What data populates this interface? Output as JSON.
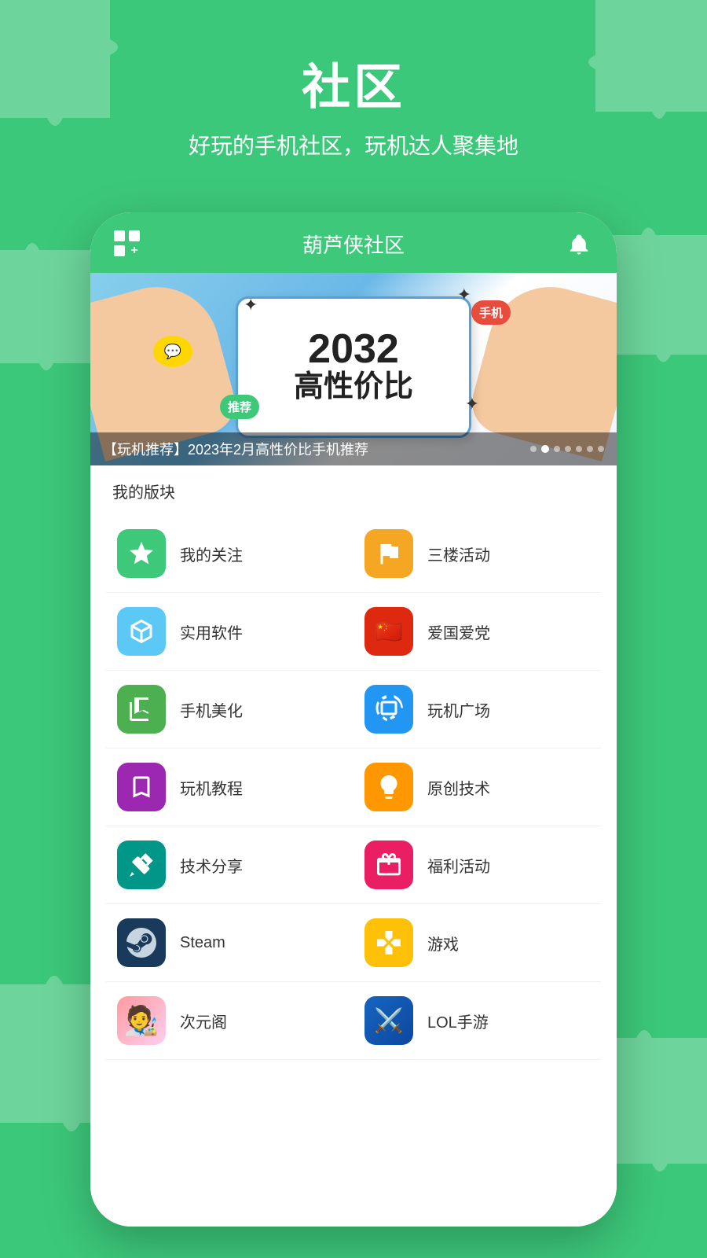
{
  "background": {
    "color": "#3cc87a"
  },
  "page": {
    "title": "社区",
    "subtitle": "好玩的手机社区，玩机达人聚集地"
  },
  "header": {
    "title": "葫芦侠社区",
    "grid_icon_label": "grid-plus-icon",
    "bell_icon_label": "bell-icon"
  },
  "banner": {
    "year": "2032",
    "text": "高性价比",
    "badge_recommend": "推荐",
    "badge_phone": "手机",
    "caption": "【玩机推荐】2023年2月高性价比手机推荐",
    "dots_count": 7,
    "active_dot": 2
  },
  "section_label": "我的版块",
  "menu_items": [
    {
      "id": "my-follow",
      "label": "我的关注",
      "icon": "star-icon",
      "color": "green"
    },
    {
      "id": "third-floor",
      "label": "三楼活动",
      "icon": "flag-icon",
      "color": "yellow"
    },
    {
      "id": "useful-apps",
      "label": "实用软件",
      "icon": "box-icon",
      "color": "blue-light"
    },
    {
      "id": "patriot",
      "label": "爱国爱党",
      "icon": "flag-cn-icon",
      "color": "red"
    },
    {
      "id": "phone-beauty",
      "label": "手机美化",
      "icon": "book-icon",
      "color": "green2"
    },
    {
      "id": "play-square",
      "label": "玩机广场",
      "icon": "phone-icon",
      "color": "blue"
    },
    {
      "id": "play-tutorial",
      "label": "玩机教程",
      "icon": "bookmark-icon",
      "color": "purple"
    },
    {
      "id": "original-tech",
      "label": "原创技术",
      "icon": "bulb-icon",
      "color": "orange"
    },
    {
      "id": "tech-share",
      "label": "技术分享",
      "icon": "wrench-icon",
      "color": "teal"
    },
    {
      "id": "welfare",
      "label": "福利活动",
      "icon": "gift-icon",
      "color": "pink"
    },
    {
      "id": "steam",
      "label": "Steam",
      "icon": "steam-icon",
      "color": "dark-blue"
    },
    {
      "id": "games",
      "label": "游戏",
      "icon": "game-icon",
      "color": "yellow2"
    },
    {
      "id": "anime",
      "label": "次元阁",
      "icon": "anime-icon",
      "color": "anime"
    },
    {
      "id": "lol",
      "label": "LOL手游",
      "icon": "lol-icon",
      "color": "lol"
    }
  ]
}
